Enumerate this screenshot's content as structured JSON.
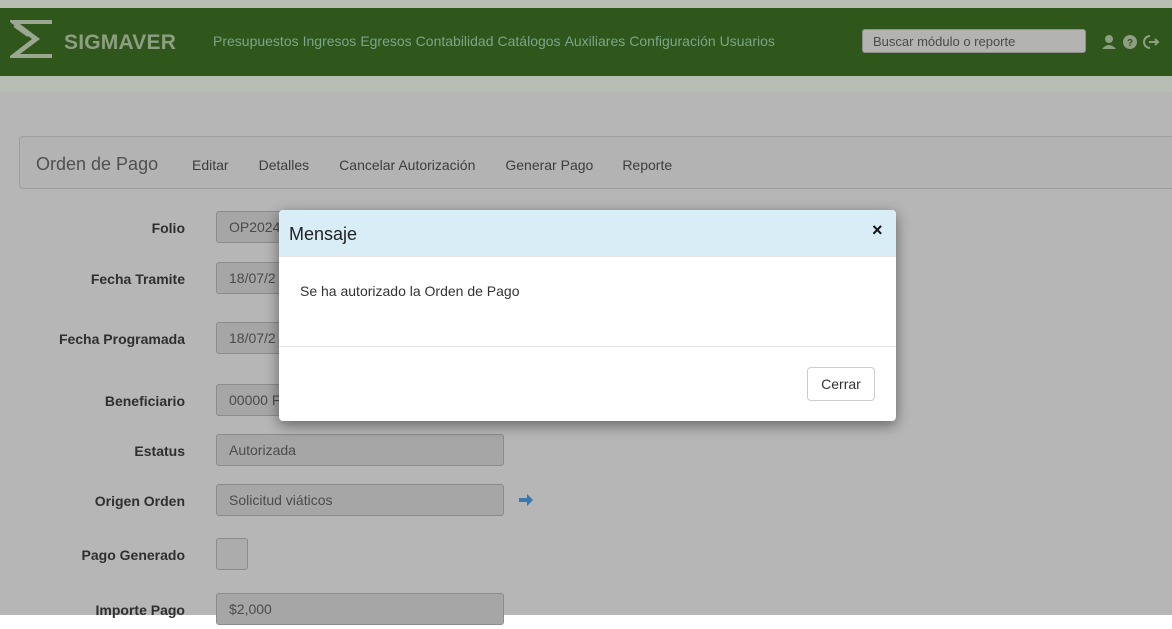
{
  "app": {
    "name": "SIGMAVER"
  },
  "nav": {
    "items": [
      "Presupuestos",
      "Ingresos",
      "Egresos",
      "Contabilidad",
      "Catálogos",
      "Auxiliares",
      "Configuración",
      "Usuarios"
    ]
  },
  "search": {
    "placeholder": "Buscar módulo o reporte"
  },
  "icons": [
    "user-icon",
    "help-icon",
    "logout-icon"
  ],
  "subnav": {
    "title": "Orden de Pago",
    "links": [
      "Editar",
      "Detalles",
      "Cancelar Autorización",
      "Generar Pago",
      "Reporte"
    ]
  },
  "form": {
    "folio": {
      "label": "Folio",
      "value": "OP2024"
    },
    "fecha_tramite": {
      "label": "Fecha Tramite",
      "value": "18/07/2"
    },
    "fecha_programada": {
      "label": "Fecha Programada",
      "value": "18/07/2"
    },
    "beneficiario": {
      "label": "Beneficiario",
      "value": "00000 F"
    },
    "estatus": {
      "label": "Estatus",
      "value": "Autorizada"
    },
    "origen_orden": {
      "label": "Origen Orden",
      "value": "Solicitud viáticos"
    },
    "pago_generado": {
      "label": "Pago Generado"
    },
    "importe_pago": {
      "label": "Importe Pago",
      "value": "$2,000"
    }
  },
  "modal": {
    "title": "Mensaje",
    "close_symbol": "×",
    "body": "Se ha autorizado la Orden de Pago",
    "button": "Cerrar"
  },
  "colors": {
    "navbar": "#2f561b",
    "modal_header": "#d9edf7",
    "arrow": "#3a78b0"
  }
}
